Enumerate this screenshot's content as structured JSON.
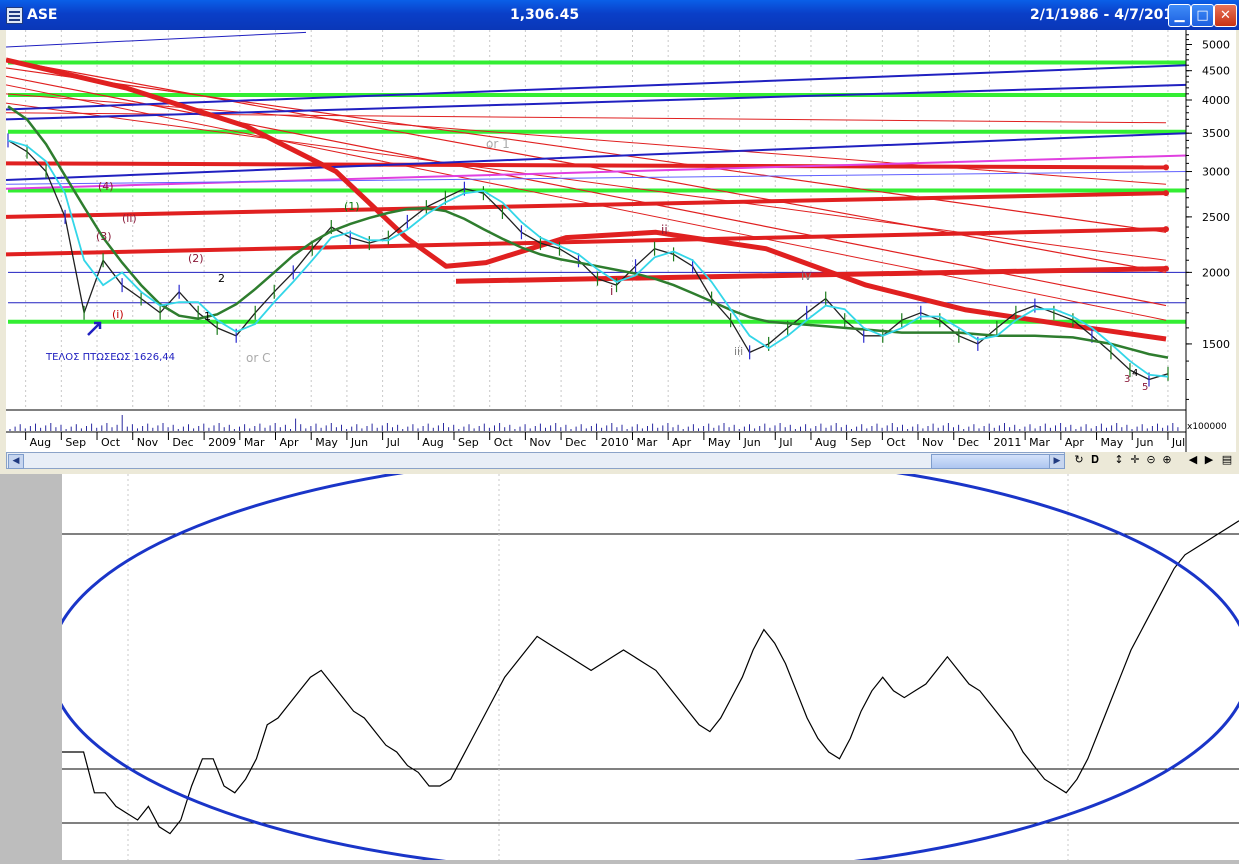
{
  "window": {
    "symbol": "ASE",
    "price": "1,306.45",
    "date_range": "2/1/1986 - 4/7/2011",
    "buttons": [
      "minimize",
      "maximize",
      "close"
    ]
  },
  "chart_data": [
    {
      "type": "line",
      "title": "ASE",
      "y_scale": "log",
      "ylim": [
        1150,
        5300
      ],
      "y_ticks": [
        1500,
        2000,
        2500,
        3000,
        3500,
        4000,
        4500,
        5000
      ],
      "y_tick_labels": [
        "1500",
        "2000",
        "2500",
        "3000",
        "3500",
        "4000",
        "4500",
        "5000"
      ],
      "x_tick_labels": [
        "Aug",
        "Sep",
        "Oct",
        "Nov",
        "Dec",
        "2009",
        "Mar",
        "Apr",
        "May",
        "Jun",
        "Jul",
        "Aug",
        "Sep",
        "Oct",
        "Nov",
        "Dec",
        "2010",
        "Mar",
        "Apr",
        "May",
        "Jun",
        "Jul",
        "Aug",
        "Sep",
        "Oct",
        "Nov",
        "Dec",
        "2011",
        "Mar",
        "Apr",
        "May",
        "Jun",
        "Jul"
      ],
      "volume_unit_label": "x100000",
      "series": [
        {
          "values": [
            3400,
            3250,
            3000,
            2500,
            1700,
            2100,
            1900,
            1800,
            1700,
            1850,
            1700,
            1600,
            1550,
            1700,
            1850,
            2000,
            2200,
            2400,
            2300,
            2250,
            2300,
            2450,
            2600,
            2700,
            2800,
            2750,
            2550,
            2350,
            2250,
            2200,
            2100,
            1950,
            1900,
            2050,
            2200,
            2150,
            2050,
            1800,
            1650,
            1450,
            1500,
            1600,
            1700,
            1800,
            1650,
            1550,
            1550,
            1650,
            1700,
            1650,
            1550,
            1500,
            1600,
            1700,
            1750,
            1700,
            1650,
            1550,
            1450,
            1350,
            1300,
            1330
          ]
        },
        {
          "values": [
            3900,
            3700,
            3350,
            2950,
            2600,
            2300,
            2080,
            1900,
            1760,
            1680,
            1660,
            1690,
            1760,
            1870,
            2000,
            2140,
            2260,
            2360,
            2430,
            2490,
            2540,
            2580,
            2590,
            2560,
            2480,
            2380,
            2290,
            2210,
            2150,
            2110,
            2080,
            2050,
            2020,
            1990,
            1950,
            1900,
            1840,
            1780,
            1720,
            1670,
            1640,
            1630,
            1620,
            1610,
            1600,
            1590,
            1580,
            1570,
            1570,
            1570,
            1570,
            1560,
            1550,
            1550,
            1550,
            1545,
            1540,
            1520,
            1500,
            1470,
            1440,
            1420
          ]
        }
      ],
      "annotations": [
        "TEΛΟΣ ΠΤΩΣΕΩΣ 1626,44",
        "or 1",
        "or C",
        "(i)",
        "(ii)",
        "(1)",
        "(2)",
        "(3)",
        "(4)",
        "i",
        "ii",
        "iii",
        "iv",
        "1",
        "2",
        "3",
        "4",
        "5"
      ]
    },
    {
      "type": "line",
      "title": "",
      "ylim": [
        0,
        100
      ],
      "values": [
        30,
        30,
        30,
        18,
        18,
        14,
        12,
        10,
        14,
        8,
        6,
        10,
        20,
        28,
        28,
        20,
        18,
        22,
        28,
        38,
        40,
        44,
        48,
        52,
        54,
        50,
        46,
        42,
        40,
        36,
        32,
        30,
        26,
        24,
        20,
        20,
        22,
        28,
        34,
        40,
        46,
        52,
        56,
        60,
        64,
        62,
        60,
        58,
        56,
        54,
        56,
        58,
        60,
        58,
        56,
        54,
        50,
        46,
        42,
        38,
        36,
        40,
        46,
        52,
        60,
        66,
        62,
        56,
        48,
        40,
        34,
        30,
        28,
        34,
        42,
        48,
        52,
        48,
        46,
        48,
        50,
        54,
        58,
        54,
        50,
        48,
        44,
        40,
        36,
        30,
        26,
        22,
        20,
        18,
        22,
        28,
        36,
        44,
        52,
        60,
        66,
        72,
        78,
        84,
        88,
        90,
        92,
        94,
        96,
        98
      ]
    }
  ]
}
